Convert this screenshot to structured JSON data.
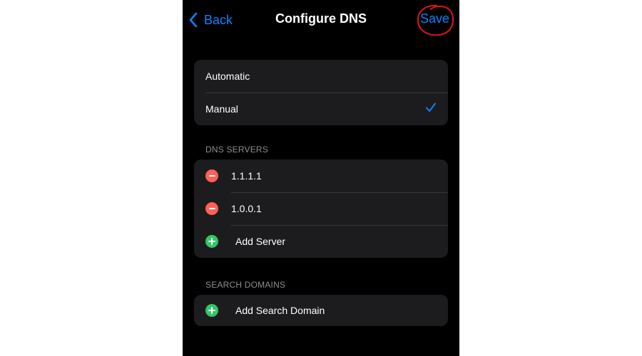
{
  "nav": {
    "back_label": "Back",
    "title": "Configure DNS",
    "save_label": "Save"
  },
  "mode": {
    "options": [
      {
        "label": "Automatic",
        "selected": false
      },
      {
        "label": "Manual",
        "selected": true
      }
    ]
  },
  "dns_servers": {
    "header": "DNS SERVERS",
    "servers": [
      "1.1.1.1",
      "1.0.0.1"
    ],
    "add_label": "Add Server"
  },
  "search_domains": {
    "header": "SEARCH DOMAINS",
    "add_label": "Add Search Domain"
  },
  "colors": {
    "accent": "#0a84ff",
    "delete": "#ff5f57",
    "add": "#32c766",
    "annotation": "#e0131b"
  },
  "icons": {
    "back": "chevron-left-icon",
    "selected": "checkmark-icon",
    "remove": "minus-circle-icon",
    "add": "plus-circle-icon"
  }
}
